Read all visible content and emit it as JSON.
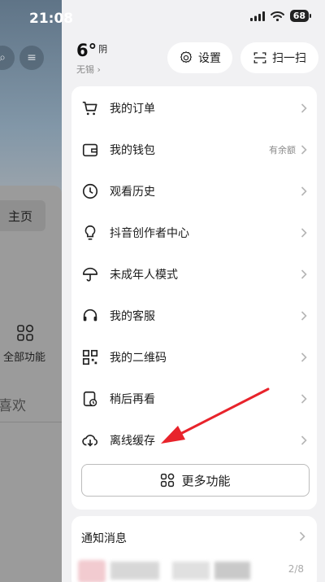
{
  "status_bar": {
    "time": "21:08",
    "battery": "68"
  },
  "background_page": {
    "tab_label": "主页",
    "feature_label": "全部功能",
    "like_label": "喜欢"
  },
  "drawer": {
    "weather": {
      "temp": "6°",
      "condition": "阴",
      "city": "无锡"
    },
    "settings_label": "设置",
    "scan_label": "扫一扫",
    "menu": [
      {
        "label": "我的订单",
        "icon": "cart-icon",
        "extra": ""
      },
      {
        "label": "我的钱包",
        "icon": "wallet-icon",
        "extra": "有余额"
      },
      {
        "label": "观看历史",
        "icon": "clock-icon",
        "extra": ""
      },
      {
        "label": "抖音创作者中心",
        "icon": "lightbulb-icon",
        "extra": ""
      },
      {
        "label": "未成年人模式",
        "icon": "umbrella-icon",
        "extra": ""
      },
      {
        "label": "我的客服",
        "icon": "headset-icon",
        "extra": ""
      },
      {
        "label": "我的二维码",
        "icon": "qrcode-icon",
        "extra": ""
      },
      {
        "label": "稍后再看",
        "icon": "watch-later-icon",
        "extra": ""
      },
      {
        "label": "离线缓存",
        "icon": "cloud-download-icon",
        "extra": ""
      }
    ],
    "more_label": "更多功能",
    "notify_title": "通知消息",
    "notify_count": "2/8"
  },
  "colors": {
    "annotation_arrow": "#e8232b",
    "drawer_bg": "#f1f1f3",
    "card_bg": "#ffffff"
  }
}
